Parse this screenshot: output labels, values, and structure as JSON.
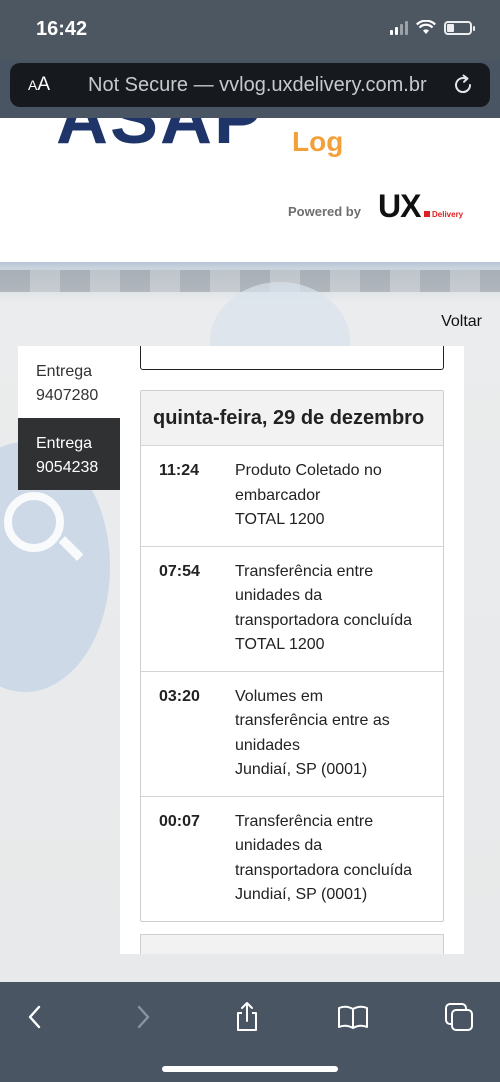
{
  "status_bar": {
    "time": "16:42",
    "battery_level": 0.3
  },
  "browser": {
    "aa_label_small": "A",
    "aa_label_large": "A",
    "url": "Not Secure — vvlog.uxdelivery.com.br"
  },
  "header": {
    "logo_main": "ASAP",
    "logo_sub": "Log",
    "powered_by": "Powered by",
    "partner_logo": "UX",
    "partner_sub": "Delivery"
  },
  "nav": {
    "back_link": "Voltar"
  },
  "tabs": [
    {
      "label_top": "Entrega",
      "label_bottom": "9407280",
      "active": false
    },
    {
      "label_top": "Entrega",
      "label_bottom": "9054238",
      "active": true
    }
  ],
  "tracking": {
    "day_title": "quinta-feira, 29 de dezembro",
    "events": [
      {
        "time": "11:24",
        "lines": [
          "Produto Coletado no",
          "embarcador",
          "TOTAL 1200"
        ]
      },
      {
        "time": "07:54",
        "lines": [
          "Transferência entre",
          "unidades da",
          "transportadora concluída",
          "TOTAL 1200"
        ]
      },
      {
        "time": "03:20",
        "lines": [
          "Volumes em",
          "transferência entre as",
          "unidades",
          "Jundiaí, SP (0001)"
        ]
      },
      {
        "time": "00:07",
        "lines": [
          "Transferência entre",
          "unidades da",
          "transportadora concluída",
          "Jundiaí, SP (0001)"
        ]
      }
    ]
  },
  "icons": {
    "reload": "reload-icon",
    "back": "chevron-left-icon",
    "forward": "chevron-right-icon",
    "share": "share-icon",
    "bookmarks": "book-icon",
    "tabs": "tabs-icon"
  },
  "colors": {
    "brand_navy": "#1f3569",
    "brand_orange": "#f2a03a",
    "active_tab": "#2f3133",
    "toolbar": "#4a5563"
  }
}
